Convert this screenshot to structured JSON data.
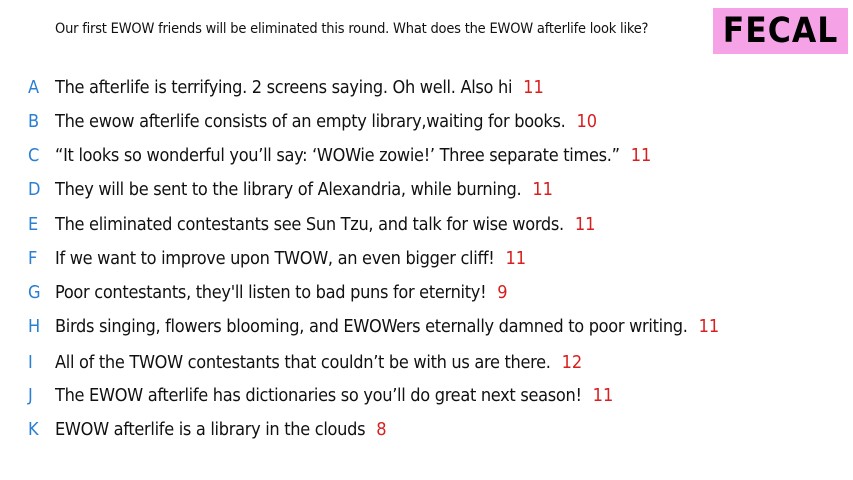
{
  "prompt": "Our first EWOW friends will be eliminated this round. What does the EWOW afterlife look like?",
  "badge": {
    "label": "FECAL",
    "background": "#f5a3e6"
  },
  "colors": {
    "letter": "#2a7fd4",
    "score": "#d81e1e"
  },
  "responses": [
    {
      "letter": "A",
      "text": "The afterlife is terrifying. 2 screens saying. Oh well. Also hi",
      "score": "11"
    },
    {
      "letter": "B",
      "text": "The ewow afterlife consists of an empty library,waiting for books.",
      "score": "10"
    },
    {
      "letter": "C",
      "text": "“It looks so wonderful you’ll say: ‘WOWie zowie!’ Three separate times.”",
      "score": "11"
    },
    {
      "letter": "D",
      "text": "They will be sent to the library of Alexandria, while burning.",
      "score": "11"
    },
    {
      "letter": "E",
      "text": "The eliminated contestants see Sun Tzu, and talk for wise words.",
      "score": "11"
    },
    {
      "letter": "F",
      "text": "If we want to improve upon TWOW, an even bigger cliff!",
      "score": "11"
    },
    {
      "letter": "G",
      "text": "Poor contestants, they'll listen to bad puns for eternity!",
      "score": "9"
    },
    {
      "letter": "H",
      "text": "Birds singing, flowers blooming, and EWOWers eternally damned to poor writing.",
      "score": "11"
    },
    {
      "letter": "I",
      "text": "All of the TWOW contestants that couldn’t be with us are there.",
      "score": "12"
    },
    {
      "letter": "J",
      "text": "The EWOW afterlife has dictionaries so you’ll do great next season!",
      "score": "11"
    },
    {
      "letter": "K",
      "text": "EWOW afterlife is a library in the clouds",
      "score": "8"
    }
  ]
}
